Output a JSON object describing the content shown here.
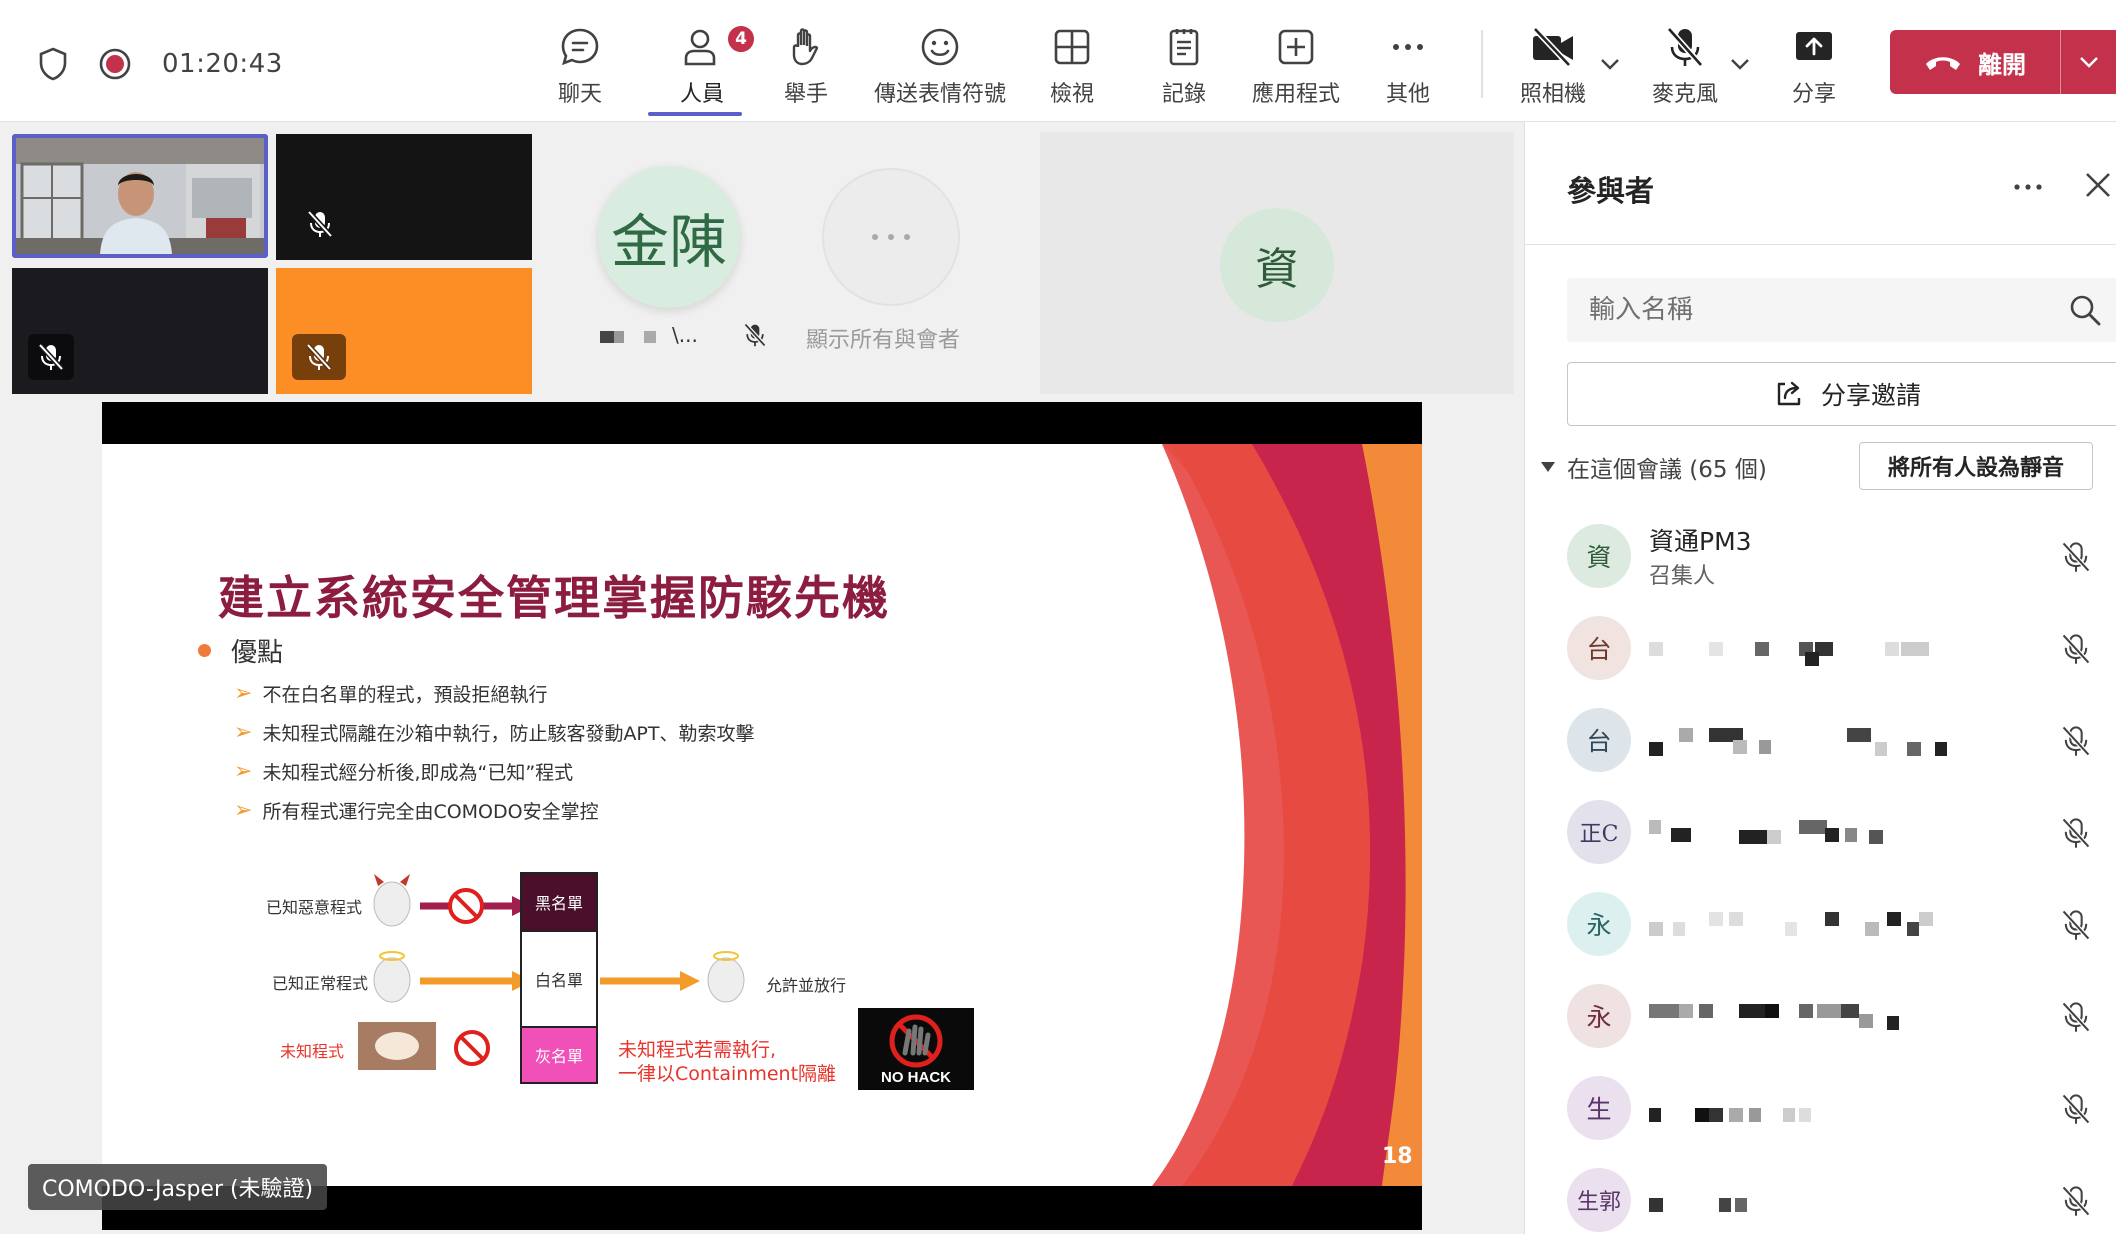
{
  "toolbar": {
    "timer": "01:20:43",
    "buttons": [
      {
        "label": "聊天",
        "icon": "chat-icon"
      },
      {
        "label": "人員",
        "icon": "people-icon",
        "badge": "4"
      },
      {
        "label": "舉手",
        "icon": "raise-hand-icon"
      },
      {
        "label": "傳送表情符號",
        "icon": "emoji-icon"
      },
      {
        "label": "檢視",
        "icon": "view-grid-icon"
      },
      {
        "label": "記錄",
        "icon": "notes-icon"
      },
      {
        "label": "應用程式",
        "icon": "apps-plus-icon"
      },
      {
        "label": "其他",
        "icon": "more-icon"
      },
      {
        "label": "照相機",
        "icon": "camera-off-icon"
      },
      {
        "label": "麥克風",
        "icon": "mic-off-icon"
      },
      {
        "label": "分享",
        "icon": "share-tray-icon"
      }
    ],
    "leave_label": "離開"
  },
  "stage": {
    "avatar_jinchen": "金陳",
    "avatar_jinchen_name_tail": "\\...",
    "show_all_label": "顯示所有與會者",
    "avatar_zi": "資",
    "presenter_name": "COMODO-Jasper (未驗證)"
  },
  "slide": {
    "title": "建立系統安全管理掌握防駭先機",
    "main_bullet": "優點",
    "sub_bullets": [
      "不在白名單的程式，預設拒絕執行",
      "未知程式隔離在沙箱中執行，防止駭客發動APT、勒索攻擊",
      "未知程式經分析後,即成為“已知”程式",
      "所有程式運行完全由COMODO安全掌控"
    ],
    "diagram": {
      "known_malicious": "已知惡意程式",
      "known_normal": "已知正常程式",
      "unknown": "未知程式",
      "blacklist": "黑名單",
      "whitelist": "白名單",
      "greylist": "灰名單",
      "allow": "允許並放行",
      "note_line1": "未知程式若需執行,",
      "note_line2": "一律以Containment隔離",
      "nohack": "NO HACK"
    },
    "page_number": "18"
  },
  "panel": {
    "title": "參與者",
    "search_placeholder": "輸入名稱",
    "share_invite": "分享邀請",
    "section_label": "在這個會議 (65 個)",
    "mute_all": "將所有人設為靜音",
    "participants": [
      {
        "initial": "資",
        "name": "資通PM3",
        "role": "召集人",
        "bg": "#dceadf",
        "fg": "#2f5a3b"
      },
      {
        "initial": "台",
        "name": "",
        "bg": "#f1e3df",
        "fg": "#6b3b2e"
      },
      {
        "initial": "台",
        "name": "",
        "bg": "#dde5ea",
        "fg": "#34495a"
      },
      {
        "initial": "正C",
        "name": "",
        "bg": "#e3e2ec",
        "fg": "#3c3a62"
      },
      {
        "initial": "永",
        "name": "",
        "bg": "#ddf0f0",
        "fg": "#2b6564"
      },
      {
        "initial": "永",
        "name": "",
        "bg": "#f0e1e3",
        "fg": "#6e2f3a"
      },
      {
        "initial": "生",
        "name": "",
        "bg": "#ebe0ee",
        "fg": "#5b356a"
      },
      {
        "initial": "生郭",
        "name": "",
        "bg": "#ebe0ee",
        "fg": "#5b356a"
      }
    ]
  },
  "colors": {
    "accent": "#5b5fc7",
    "leave_red": "#c4314b",
    "slide_title": "#8c1d40"
  }
}
